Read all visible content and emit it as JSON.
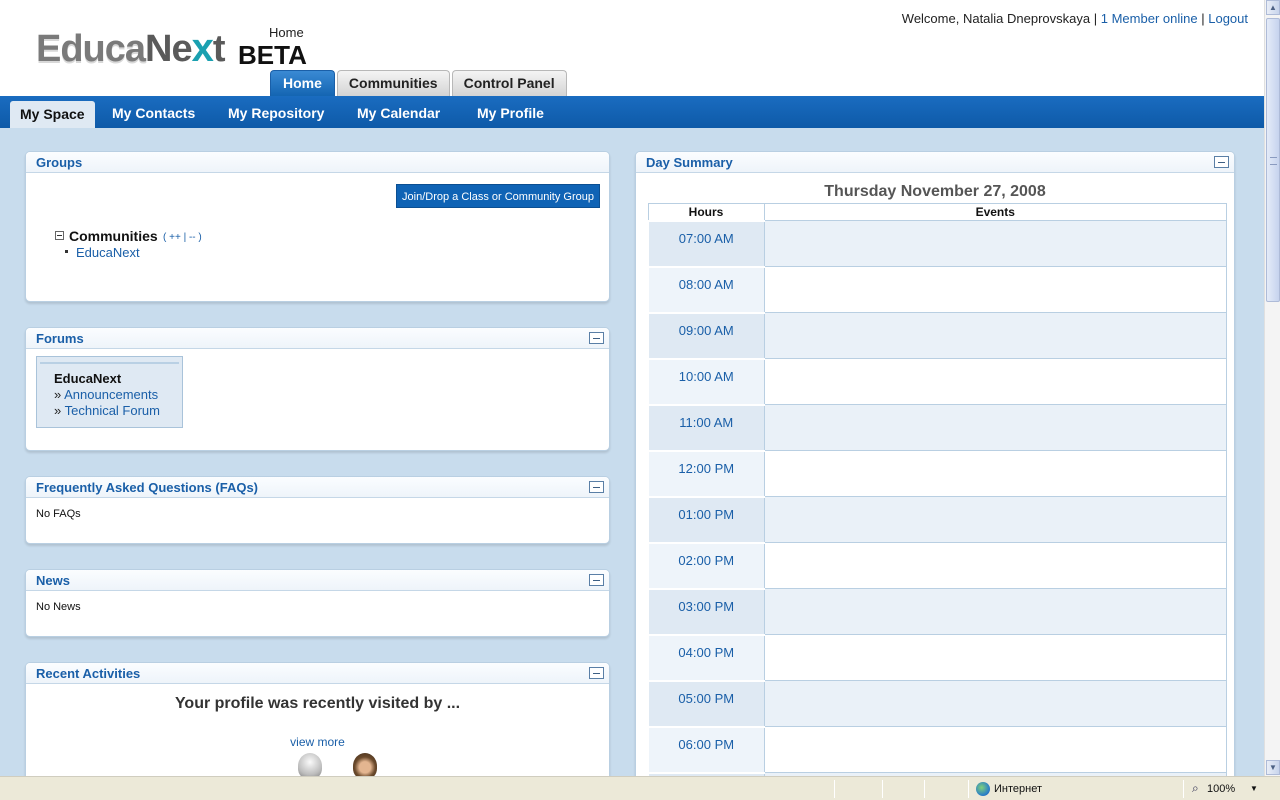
{
  "header": {
    "logo": {
      "part1": "Educa",
      "part2": "Ne",
      "part3": "x",
      "part4": "t",
      "beta": "BETA"
    },
    "breadcrumb": "Home",
    "welcome_text": "Welcome, Natalia Dneprovskaya",
    "separator": "|",
    "members_online": "1 Member online",
    "logout": "Logout"
  },
  "main_tabs": [
    {
      "label": "Home",
      "active": true
    },
    {
      "label": "Communities",
      "active": false
    },
    {
      "label": "Control Panel",
      "active": false
    }
  ],
  "sub_tabs": [
    {
      "label": "My Space",
      "active": true
    },
    {
      "label": "My Contacts",
      "active": false
    },
    {
      "label": "My Repository",
      "active": false
    },
    {
      "label": "My Calendar",
      "active": false
    },
    {
      "label": "My Profile",
      "active": false
    }
  ],
  "groups": {
    "title": "Groups",
    "join_button": "Join/Drop a Class or Community Group",
    "communities_label": "Communities",
    "communities_actions": "( ++ | -- )",
    "items": [
      "EducaNext"
    ]
  },
  "forums": {
    "title": "Forums",
    "forum_name": "EducaNext",
    "bullet": "»",
    "links": [
      "Announcements",
      "Technical Forum"
    ]
  },
  "faqs": {
    "title": "Frequently Asked Questions (FAQs)",
    "text": "No FAQs"
  },
  "news": {
    "title": "News",
    "text": "No News"
  },
  "recent": {
    "title": "Recent Activities",
    "visited_text": "Your profile was recently visited by ...",
    "view_more": "view more"
  },
  "day_summary": {
    "title": "Day Summary",
    "date": "Thursday November 27, 2008",
    "col_hours": "Hours",
    "col_events": "Events",
    "hours": [
      "07:00 AM",
      "08:00 AM",
      "09:00 AM",
      "10:00 AM",
      "11:00 AM",
      "12:00 PM",
      "01:00 PM",
      "02:00 PM",
      "03:00 PM",
      "04:00 PM",
      "05:00 PM",
      "06:00 PM"
    ]
  },
  "statusbar": {
    "zone": "Интернет",
    "zoom": "100%"
  },
  "colors": {
    "accent": "#1a5fa8",
    "nav_blue": "#0e5aa8",
    "content_bg": "#c8dced",
    "portlet_border": "#b9cfe2"
  },
  "icons": {
    "collapse": "minus-box-icon",
    "tree_toggle": "tree-minus-icon",
    "zone": "globe-icon",
    "zoom": "magnifier-icon"
  }
}
